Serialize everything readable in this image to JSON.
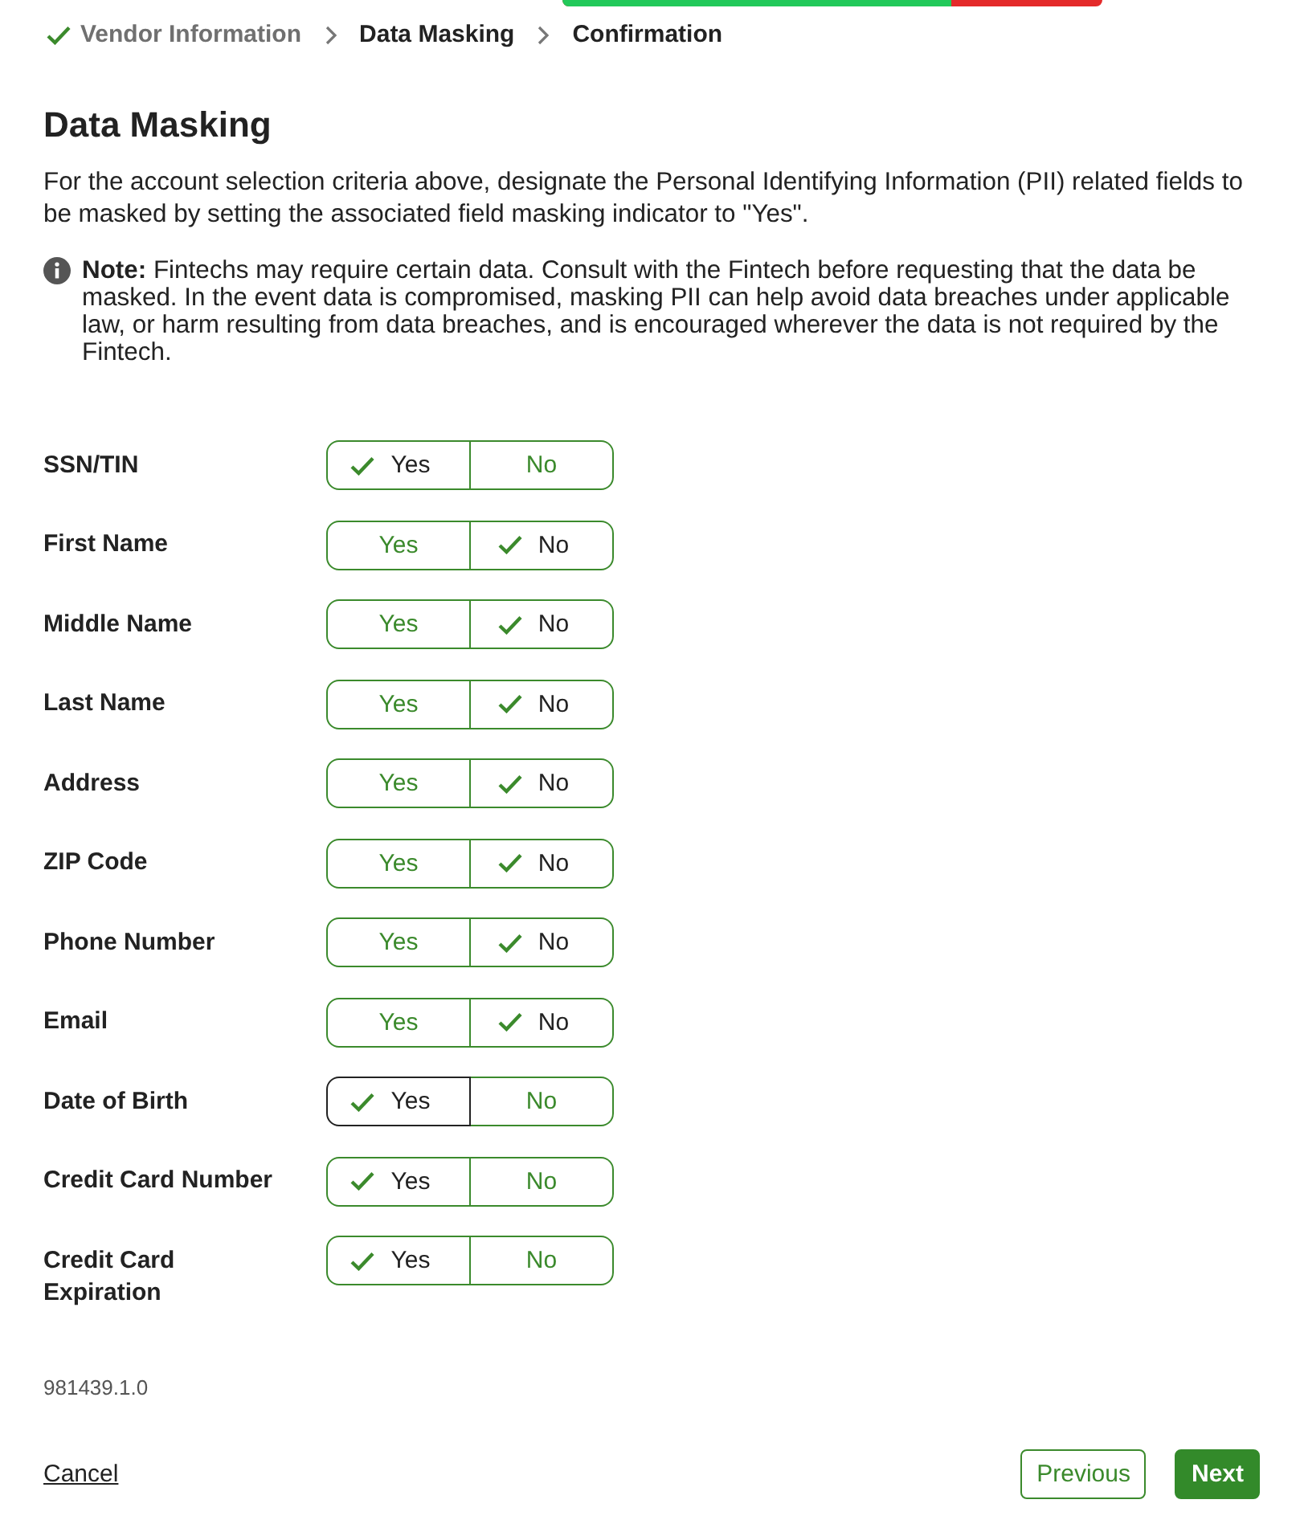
{
  "progress": {
    "level": 0.72
  },
  "breadcrumb": [
    {
      "label": "Vendor Information",
      "completed": true
    },
    {
      "label": "Data Masking",
      "completed": false
    },
    {
      "label": "Confirmation",
      "completed": false
    }
  ],
  "title": "Data Masking",
  "description": "For the account selection criteria above, designate the Personal Identifying Information (PII) related fields to be masked by setting the associated field masking indicator to \"Yes\".",
  "note": "**Note:** Fintechs may require certain data. Consult with the Fintech before requesting that the data be masked. In the event data is compromised, masking PII can help avoid data breaches under applicable law, or harm resulting from data breaches, and is encouraged wherever the data is not required by the Fintech.",
  "fields": [
    {
      "label": "SSN/TIN",
      "options": [
        {
          "label": "Yes",
          "selected": true,
          "focused": false
        },
        {
          "label": "No",
          "selected": false,
          "focused": false
        }
      ]
    },
    {
      "label": "First Name",
      "options": [
        {
          "label": "Yes",
          "selected": false,
          "focused": false
        },
        {
          "label": "No",
          "selected": true,
          "focused": false
        }
      ]
    },
    {
      "label": "Middle Name",
      "options": [
        {
          "label": "Yes",
          "selected": false,
          "focused": false
        },
        {
          "label": "No",
          "selected": true,
          "focused": false
        }
      ]
    },
    {
      "label": "Last Name",
      "options": [
        {
          "label": "Yes",
          "selected": false,
          "focused": false
        },
        {
          "label": "No",
          "selected": true,
          "focused": false
        }
      ]
    },
    {
      "label": "Address",
      "options": [
        {
          "label": "Yes",
          "selected": false,
          "focused": false
        },
        {
          "label": "No",
          "selected": true,
          "focused": false
        }
      ]
    },
    {
      "label": "ZIP Code",
      "options": [
        {
          "label": "Yes",
          "selected": false,
          "focused": false
        },
        {
          "label": "No",
          "selected": true,
          "focused": false
        }
      ]
    },
    {
      "label": "Phone Number",
      "options": [
        {
          "label": "Yes",
          "selected": false,
          "focused": false
        },
        {
          "label": "No",
          "selected": true,
          "focused": false
        }
      ]
    },
    {
      "label": "Email",
      "options": [
        {
          "label": "Yes",
          "selected": false,
          "focused": false
        },
        {
          "label": "No",
          "selected": true,
          "focused": false
        }
      ]
    },
    {
      "label": "Date of Birth",
      "options": [
        {
          "label": "Yes",
          "selected": true,
          "focused": true
        },
        {
          "label": "No",
          "selected": false,
          "focused": false
        }
      ]
    },
    {
      "label": "Credit Card Number",
      "options": [
        {
          "label": "Yes",
          "selected": true,
          "focused": false
        },
        {
          "label": "No",
          "selected": false,
          "focused": false
        }
      ]
    },
    {
      "label": "Credit Card Expiration",
      "options": [
        {
          "label": "Yes",
          "selected": true,
          "focused": false
        },
        {
          "label": "No",
          "selected": false,
          "focused": false
        }
      ]
    }
  ],
  "version": "981439.1.0",
  "cancel": "Cancel",
  "buttons": [
    {
      "label": "Previous",
      "kind": "secondary"
    },
    {
      "label": "Next",
      "kind": "primary"
    }
  ]
}
